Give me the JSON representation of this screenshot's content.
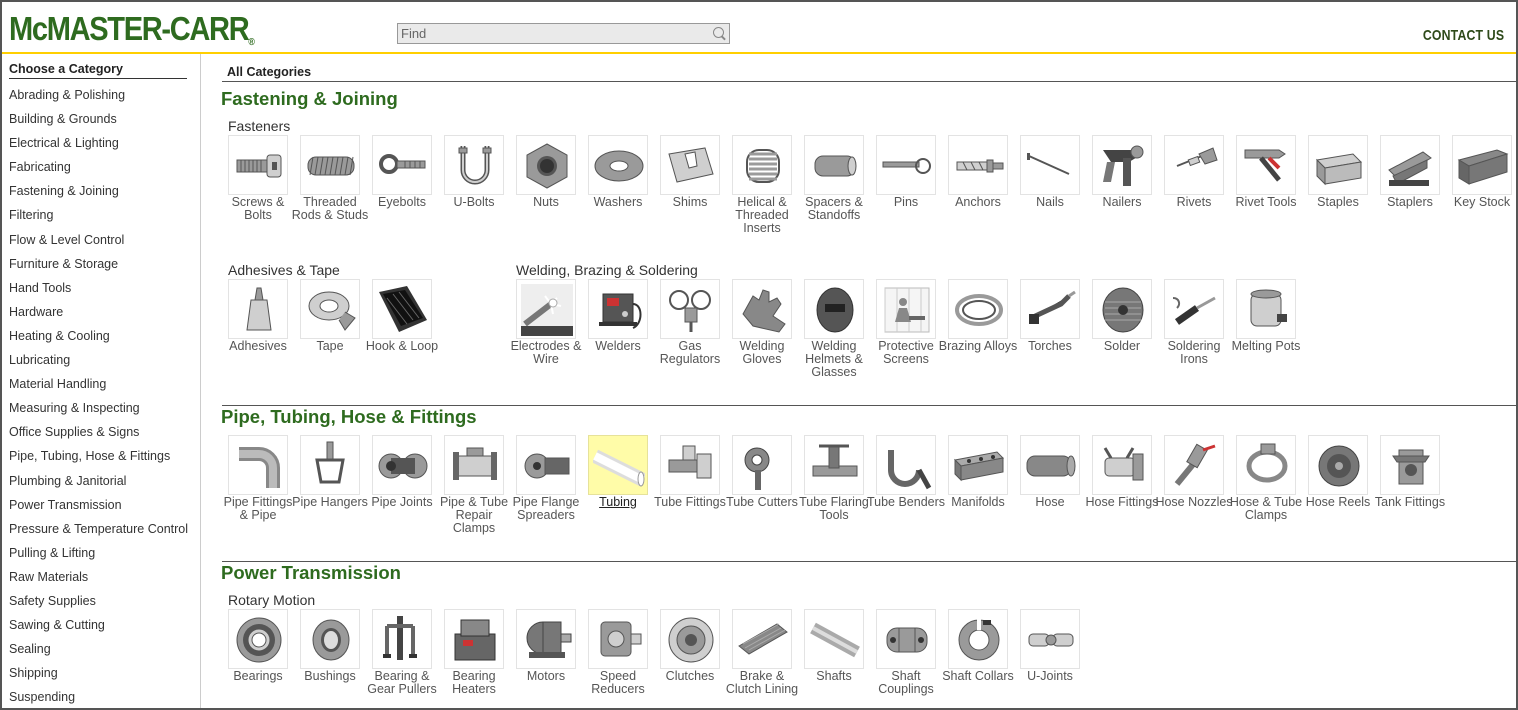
{
  "header": {
    "logo_text": "McMASTER-CARR",
    "logo_mark": "®",
    "search_placeholder": "Find",
    "contact_label": "CONTACT US"
  },
  "sidebar": {
    "title": "Choose a Category",
    "items": [
      "Abrading & Polishing",
      "Building & Grounds",
      "Electrical & Lighting",
      "Fabricating",
      "Fastening & Joining",
      "Filtering",
      "Flow & Level Control",
      "Furniture & Storage",
      "Hand Tools",
      "Hardware",
      "Heating & Cooling",
      "Lubricating",
      "Material Handling",
      "Measuring & Inspecting",
      "Office Supplies & Signs",
      "Pipe, Tubing, Hose & Fittings",
      "Plumbing & Janitorial",
      "Power Transmission",
      "Pressure & Temperature Control",
      "Pulling & Lifting",
      "Raw Materials",
      "Safety Supplies",
      "Sawing & Cutting",
      "Sealing",
      "Shipping",
      "Suspending"
    ]
  },
  "main": {
    "all_categories_label": "All Categories",
    "sections": [
      {
        "title": "Fastening & Joining",
        "groups": [
          {
            "title": "Fasteners",
            "items": [
              {
                "label": "Screws & Bolts",
                "icon": "screw-icon"
              },
              {
                "label": "Threaded Rods & Studs",
                "icon": "threaded-rod-icon"
              },
              {
                "label": "Eyebolts",
                "icon": "eyebolt-icon"
              },
              {
                "label": "U-Bolts",
                "icon": "u-bolt-icon"
              },
              {
                "label": "Nuts",
                "icon": "nut-icon"
              },
              {
                "label": "Washers",
                "icon": "washer-icon"
              },
              {
                "label": "Shims",
                "icon": "shim-icon"
              },
              {
                "label": "Helical & Threaded Inserts",
                "icon": "helical-insert-icon"
              },
              {
                "label": "Spacers & Standoffs",
                "icon": "spacer-icon"
              },
              {
                "label": "Pins",
                "icon": "pin-icon"
              },
              {
                "label": "Anchors",
                "icon": "anchor-icon"
              },
              {
                "label": "Nails",
                "icon": "nail-icon"
              },
              {
                "label": "Nailers",
                "icon": "nailer-icon"
              },
              {
                "label": "Rivets",
                "icon": "rivet-icon"
              },
              {
                "label": "Rivet Tools",
                "icon": "rivet-tool-icon"
              },
              {
                "label": "Staples",
                "icon": "staples-icon"
              },
              {
                "label": "Staplers",
                "icon": "stapler-icon"
              },
              {
                "label": "Key Stock",
                "icon": "key-stock-icon"
              }
            ]
          },
          {
            "title": "Adhesives & Tape",
            "items": [
              {
                "label": "Adhesives",
                "icon": "adhesive-icon"
              },
              {
                "label": "Tape",
                "icon": "tape-icon"
              },
              {
                "label": "Hook & Loop",
                "icon": "hook-loop-icon"
              }
            ]
          },
          {
            "title": "Welding, Brazing & Soldering",
            "items": [
              {
                "label": "Electrodes & Wire",
                "icon": "electrode-icon"
              },
              {
                "label": "Welders",
                "icon": "welder-icon"
              },
              {
                "label": "Gas Regulators",
                "icon": "gas-regulator-icon"
              },
              {
                "label": "Welding Gloves",
                "icon": "welding-glove-icon"
              },
              {
                "label": "Welding Helmets & Glasses",
                "icon": "welding-helmet-icon"
              },
              {
                "label": "Protective Screens",
                "icon": "protective-screen-icon"
              },
              {
                "label": "Brazing Alloys",
                "icon": "brazing-alloy-icon"
              },
              {
                "label": "Torches",
                "icon": "torch-icon"
              },
              {
                "label": "Solder",
                "icon": "solder-icon"
              },
              {
                "label": "Soldering Irons",
                "icon": "soldering-iron-icon"
              },
              {
                "label": "Melting Pots",
                "icon": "melting-pot-icon"
              }
            ]
          }
        ]
      },
      {
        "title": "Pipe, Tubing, Hose & Fittings",
        "groups": [
          {
            "title": "",
            "items": [
              {
                "label": "Pipe Fittings & Pipe",
                "icon": "pipe-fitting-icon"
              },
              {
                "label": "Pipe Hangers",
                "icon": "pipe-hanger-icon"
              },
              {
                "label": "Pipe Joints",
                "icon": "pipe-joint-icon"
              },
              {
                "label": "Pipe & Tube Repair Clamps",
                "icon": "repair-clamp-icon"
              },
              {
                "label": "Pipe Flange Spreaders",
                "icon": "flange-spreader-icon"
              },
              {
                "label": "Tubing",
                "icon": "tubing-icon"
              },
              {
                "label": "Tube Fittings",
                "icon": "tube-fitting-icon"
              },
              {
                "label": "Tube Cutters",
                "icon": "tube-cutter-icon"
              },
              {
                "label": "Tube Flaring Tools",
                "icon": "flaring-tool-icon"
              },
              {
                "label": "Tube Benders",
                "icon": "tube-bender-icon"
              },
              {
                "label": "Manifolds",
                "icon": "manifold-icon"
              },
              {
                "label": "Hose",
                "icon": "hose-icon"
              },
              {
                "label": "Hose Fittings",
                "icon": "hose-fitting-icon"
              },
              {
                "label": "Hose Nozzles",
                "icon": "hose-nozzle-icon"
              },
              {
                "label": "Hose & Tube Clamps",
                "icon": "hose-clamp-icon"
              },
              {
                "label": "Hose Reels",
                "icon": "hose-reel-icon"
              },
              {
                "label": "Tank Fittings",
                "icon": "tank-fitting-icon"
              }
            ]
          }
        ]
      },
      {
        "title": "Power Transmission",
        "groups": [
          {
            "title": "Rotary Motion",
            "items": [
              {
                "label": "Bearings",
                "icon": "bearing-icon"
              },
              {
                "label": "Bushings",
                "icon": "bushing-icon"
              },
              {
                "label": "Bearing & Gear Pullers",
                "icon": "puller-icon"
              },
              {
                "label": "Bearing Heaters",
                "icon": "bearing-heater-icon"
              },
              {
                "label": "Motors",
                "icon": "motor-icon"
              },
              {
                "label": "Speed Reducers",
                "icon": "speed-reducer-icon"
              },
              {
                "label": "Clutches",
                "icon": "clutch-icon"
              },
              {
                "label": "Brake & Clutch Lining",
                "icon": "brake-lining-icon"
              },
              {
                "label": "Shafts",
                "icon": "shaft-icon"
              },
              {
                "label": "Shaft Couplings",
                "icon": "shaft-coupling-icon"
              },
              {
                "label": "Shaft Collars",
                "icon": "shaft-collar-icon"
              },
              {
                "label": "U-Joints",
                "icon": "u-joint-icon"
              }
            ]
          }
        ]
      }
    ]
  },
  "colors": {
    "brand_green": "#2e6b1f",
    "accent_yellow": "#ffcf00",
    "highlight": "#fffca8"
  }
}
